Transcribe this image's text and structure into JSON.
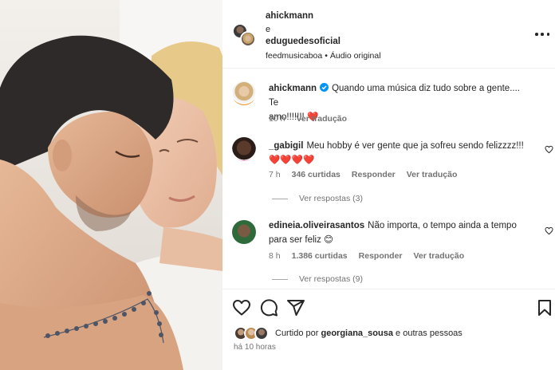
{
  "header": {
    "user1": "ahickmann",
    "connector": "e",
    "user2": "eduguedesoficial",
    "audio_account": "feedmusicaboa",
    "audio_separator": "•",
    "audio_label": "Áudio original"
  },
  "comments": [
    {
      "user": "ahickmann",
      "verified": true,
      "text_line1": "Quando uma música diz tudo sobre a gente.... Te",
      "text_line2": "amo!!!!!!!",
      "emoji": "❤️",
      "time": "10 h",
      "translate": "Ver tradução"
    },
    {
      "user": "_gabigil",
      "text": "Meu hobby é ver gente que ja sofreu sendo felizzzz!!!",
      "emojis": "❤️❤️❤️❤️",
      "time": "7 h",
      "likes": "346 curtidas",
      "reply": "Responder",
      "translate": "Ver tradução",
      "view_replies": "Ver respostas (3)"
    },
    {
      "user": "edineia.oliveirasantos",
      "text_line1": "Não importa, o tempo ainda a tempo",
      "text_line2": "para ser feliz",
      "emoji": "😊",
      "time": "8 h",
      "likes": "1.386 curtidas",
      "reply": "Responder",
      "translate": "Ver tradução",
      "view_replies": "Ver respostas (9)"
    }
  ],
  "likes": {
    "prefix": "Curtido por",
    "user": "georgiana_sousa",
    "suffix": "e outras pessoas"
  },
  "post_time": "há 10 horas",
  "icons": [
    "heart-icon",
    "comment-icon",
    "share-icon",
    "bookmark-icon",
    "more-icon",
    "verified-badge-icon"
  ],
  "colors": {
    "like_red": "#ed4956",
    "verified_blue": "#0095f6",
    "muted_text": "#737373"
  }
}
